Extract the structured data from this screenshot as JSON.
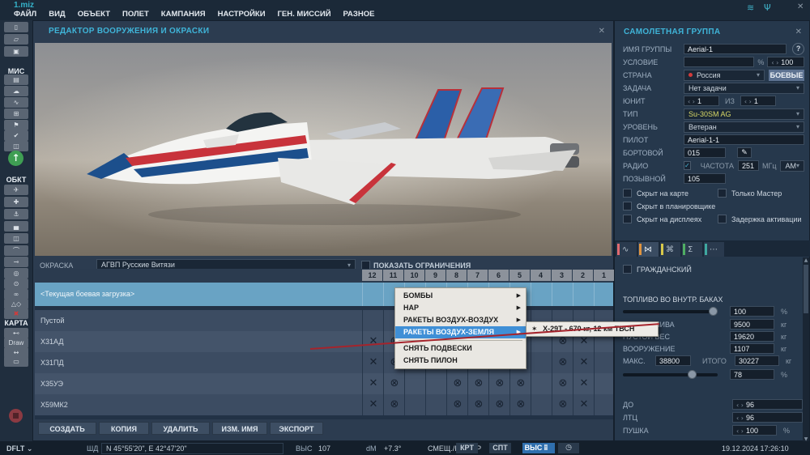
{
  "window": {
    "file": "1.miz"
  },
  "menubar": {
    "items": [
      "ФАЙЛ",
      "ВИД",
      "ОБЪЕКТ",
      "ПОЛЕТ",
      "КАМПАНИЯ",
      "НАСТРОЙКИ",
      "ГЕН. МИССИЙ",
      "РАЗНОЕ"
    ]
  },
  "icons": {
    "close": "✕",
    "wifi": "≋",
    "antenna": "Ψ",
    "chevron": "▾",
    "chevron_small": "⌄",
    "help": "?",
    "check": "✓",
    "spin_left": "‹",
    "spin_right": "›",
    "edit": "✎",
    "submenu_arrow": "▶",
    "missile": "✶",
    "scroll_up": "▲",
    "scroll_down": "▼",
    "map_layer": "▦",
    "clock": "◷",
    "play": "↑"
  },
  "colors": {
    "accent_cyan": "#3fb4d8",
    "selected_row": "#69a3c4",
    "menu_highlight": "#3f8fd6",
    "type_yellow": "#d9d966",
    "annotation_red": "#a5242c",
    "country_dot": "#d23b3b"
  },
  "sidebar": {
    "items": [
      {
        "t": "btn",
        "name": "new-mission-button",
        "icon": "new-file-icon",
        "g": "▯"
      },
      {
        "t": "btn",
        "name": "open-mission-button",
        "icon": "open-folder-icon",
        "g": "▱"
      },
      {
        "t": "btn",
        "name": "save-mission-button",
        "icon": "save-icon",
        "g": "▣"
      },
      {
        "t": "lbl",
        "name": "sidebar-label-mis",
        "text": "МИС"
      },
      {
        "t": "btn",
        "name": "briefing-button",
        "icon": "clipboard-icon",
        "g": "▤"
      },
      {
        "t": "btn",
        "name": "weather-button",
        "icon": "cloud-icon",
        "g": "☁"
      },
      {
        "t": "btn",
        "name": "route-tool-button",
        "icon": "route-icon",
        "g": "∿"
      },
      {
        "t": "btn",
        "name": "gates-button",
        "icon": "gate-icon",
        "g": "⊞"
      },
      {
        "t": "btn",
        "name": "flags-button",
        "icon": "flag-icon",
        "g": "⚑"
      },
      {
        "t": "btn",
        "name": "goals-button",
        "icon": "check-icon",
        "g": "✔"
      },
      {
        "t": "btn",
        "name": "triggers-button",
        "icon": "triggers-icon",
        "g": "◫"
      },
      {
        "t": "play",
        "name": "fly-mission-button",
        "icon": "up-arrow-icon",
        "g": "↑"
      },
      {
        "t": "lbl",
        "name": "sidebar-label-obkt",
        "text": "ОБКТ"
      },
      {
        "t": "btn",
        "name": "add-airplane-button",
        "icon": "airplane-icon",
        "g": "✈"
      },
      {
        "t": "btn",
        "name": "add-helicopter-button",
        "icon": "helicopter-icon",
        "g": "✚"
      },
      {
        "t": "btn",
        "name": "add-ship-button",
        "icon": "ship-icon",
        "g": "⚓"
      },
      {
        "t": "btn",
        "name": "add-vehicle-button",
        "icon": "vehicle-icon",
        "g": "▄"
      },
      {
        "t": "btn",
        "name": "add-static-button",
        "icon": "static-object-icon",
        "g": "◫"
      },
      {
        "t": "btn",
        "name": "add-airbase-button",
        "icon": "bridge-icon",
        "g": "⌒"
      },
      {
        "t": "btn",
        "name": "add-waypoint-button",
        "icon": "waypoint-icon",
        "g": "⊸"
      },
      {
        "t": "btn",
        "name": "template-button",
        "icon": "template-icon",
        "g": "◎"
      },
      {
        "t": "btn",
        "name": "zone-button",
        "icon": "zone-icon",
        "g": "⊙"
      },
      {
        "t": "btn",
        "name": "sequence-button",
        "icon": "sequence-icon",
        "g": "∞"
      },
      {
        "t": "btn",
        "name": "shapes-button",
        "icon": "shapes-icon",
        "g": "△◇"
      },
      {
        "t": "del",
        "name": "delete-object-button",
        "icon": "delete-x-icon",
        "g": "✖"
      },
      {
        "t": "lbl",
        "name": "sidebar-label-karta",
        "text": "КАРТА"
      },
      {
        "t": "btn",
        "name": "measure-button",
        "icon": "measure-icon",
        "g": "⊷"
      },
      {
        "t": "txt",
        "name": "draw-button",
        "text": "Draw"
      },
      {
        "t": "btn",
        "name": "ruler-button",
        "icon": "ruler-icon",
        "g": "↔"
      },
      {
        "t": "btn",
        "name": "rect-tool-button",
        "icon": "rectangle-icon",
        "g": "▭"
      },
      {
        "t": "rec",
        "name": "record-button",
        "icon": "record-icon",
        "g": "●"
      }
    ]
  },
  "editor": {
    "title": "РЕДАКТОР ВООРУЖЕНИЯ И ОКРАСКИ",
    "livery_label": "ОКРАСКА",
    "livery_value": "АГВП Русские Витязи",
    "show_limits_label": "ПОКАЗАТЬ ОГРАНИЧЕНИЯ",
    "pylons": [
      "12",
      "11",
      "10",
      "9",
      "8",
      "7",
      "6",
      "5",
      "4",
      "3",
      "2",
      "1"
    ],
    "cell_glyphs": {
      "x": "✕",
      "o": "⊗"
    },
    "rows": [
      {
        "label": "<Текущая боевая загрузка>",
        "selected": true,
        "cells": {}
      },
      {
        "label": "Пустой",
        "cells": {}
      },
      {
        "label": "Х31АД",
        "cells": {
          "12": "x",
          "11": "o",
          "7": "o",
          "6": "o",
          "3": "o",
          "2": "x"
        }
      },
      {
        "label": "Х31ПД",
        "cells": {
          "12": "x",
          "11": "o",
          "7": "o",
          "6": "o",
          "3": "o",
          "2": "x"
        }
      },
      {
        "label": "Х35УЭ",
        "cells": {
          "12": "x",
          "11": "o",
          "8": "o",
          "7": "o",
          "6": "o",
          "5": "o",
          "3": "o",
          "2": "x"
        }
      },
      {
        "label": "Х59МК2",
        "cells": {
          "12": "x",
          "11": "o",
          "8": "o",
          "7": "o",
          "6": "o",
          "5": "o",
          "3": "o",
          "2": "x"
        }
      }
    ],
    "actions": [
      "СОЗДАТЬ",
      "КОПИЯ",
      "УДАЛИТЬ",
      "ИЗМ. ИМЯ",
      "ЭКСПОРТ"
    ]
  },
  "context_menu": {
    "items": [
      {
        "label": "БОМБЫ",
        "submenu": true
      },
      {
        "label": "НАР",
        "submenu": true
      },
      {
        "label": "РАКЕТЫ ВОЗДУХ-ВОЗДУХ",
        "submenu": true
      },
      {
        "label": "РАКЕТЫ ВОЗДУХ-ЗЕМЛЯ",
        "submenu": true,
        "active": true
      },
      {
        "label": "СНЯТЬ ПОДВЕСКИ",
        "sep_before": true
      },
      {
        "label": "СНЯТЬ ПИЛОН"
      }
    ],
    "submenu_items": [
      {
        "label": "Х-29Т - 670 кг, 12 км  ТВСН"
      }
    ]
  },
  "group": {
    "title": "САМОЛЕТНАЯ ГРУППА",
    "name_label": "ИМЯ ГРУППЫ",
    "name_value": "Aerial-1",
    "condition_label": "УСЛОВИЕ",
    "condition_value": "",
    "percent": "%",
    "probability_value": "100",
    "country_label": "СТРАНА",
    "country_value": "Россия",
    "combatants_label": "БОЕВЫЕ",
    "task_label": "ЗАДАЧА",
    "task_value": "Нет задачи",
    "unit_label": "ЮНИТ",
    "unit_value": "1",
    "of_label": "ИЗ",
    "unit_total": "1",
    "type_label": "ТИП",
    "type_value": "Su-30SM AG",
    "skill_label": "УРОВЕНЬ",
    "skill_value": "Ветеран",
    "pilot_label": "ПИЛОТ",
    "pilot_value": "Aerial-1-1",
    "board_label": "БОРТОВОЙ",
    "board_value": "015",
    "radio_label": "РАДИО",
    "freq_label": "ЧАСТОТА",
    "freq_value": "251",
    "mhz_label": "МГц",
    "mod_value": "AM",
    "callsign_label": "ПОЗЫВНОЙ",
    "callsign_value": "105",
    "cb_hidden_map": "Скрыт на карте",
    "cb_master_only": "Только Мастер",
    "cb_hidden_planner": "Скрыт в планировщике",
    "cb_hidden_mfd": "Скрыт на дисплеях",
    "cb_late_activation": "Задержка активации",
    "cb_civilian": "ГРАЖДАНСКИЙ",
    "fuel_label": "ТОПЛИВО ВО ВНУТР. БАКАХ",
    "fuel_pct": "100",
    "fuel_weight_label": "ВЕС ТОПЛИВА",
    "fuel_weight": "9500",
    "empty_weight_label": "ПУСТОЙ ВЕС",
    "empty_weight": "19620",
    "weapons_label": "ВООРУЖЕНИЕ",
    "weapons_weight": "1107",
    "max_label": "МАКС.",
    "max_value": "38800",
    "total_label": "ИТОГО",
    "total_value": "30227",
    "load_pct": "78",
    "kg": "кг",
    "chaff_label": "ДО",
    "chaff_value": "96",
    "flare_label": "ЛТЦ",
    "flare_value": "96",
    "gun_label": "ПУШКА",
    "gun_value": "100"
  },
  "tabs": [
    {
      "name": "tab-route",
      "icon": "route-icon",
      "color": "#e06a70",
      "glyph": "∿"
    },
    {
      "name": "tab-payload",
      "icon": "payload-icon",
      "color": "#e0943f",
      "glyph": "⋈",
      "active": true
    },
    {
      "name": "tab-systems",
      "icon": "systems-icon",
      "color": "#d8c84a",
      "glyph": "⌘"
    },
    {
      "name": "tab-summary",
      "icon": "sigma-icon",
      "color": "#4fae63",
      "glyph": "Σ"
    },
    {
      "name": "tab-more",
      "icon": "ellipsis-icon",
      "color": "#3fa8a0",
      "glyph": "⋯"
    }
  ],
  "statusbar": {
    "layer": "DFLT",
    "coord_label": "ШД",
    "coords": "N 45°55'20\", E 42°47'20\"",
    "alt_label": "ВЫС",
    "alt_value": "107",
    "dm_label": "dM",
    "dm_value": "+7.3°",
    "mode": "СМЕЩ./ВЫБОР",
    "toggles": [
      {
        "label": "КРТ"
      },
      {
        "label": "СПТ"
      },
      {
        "label": "ВЫС",
        "active": true
      }
    ],
    "datetime": "19.12.2024 17:26:10"
  }
}
